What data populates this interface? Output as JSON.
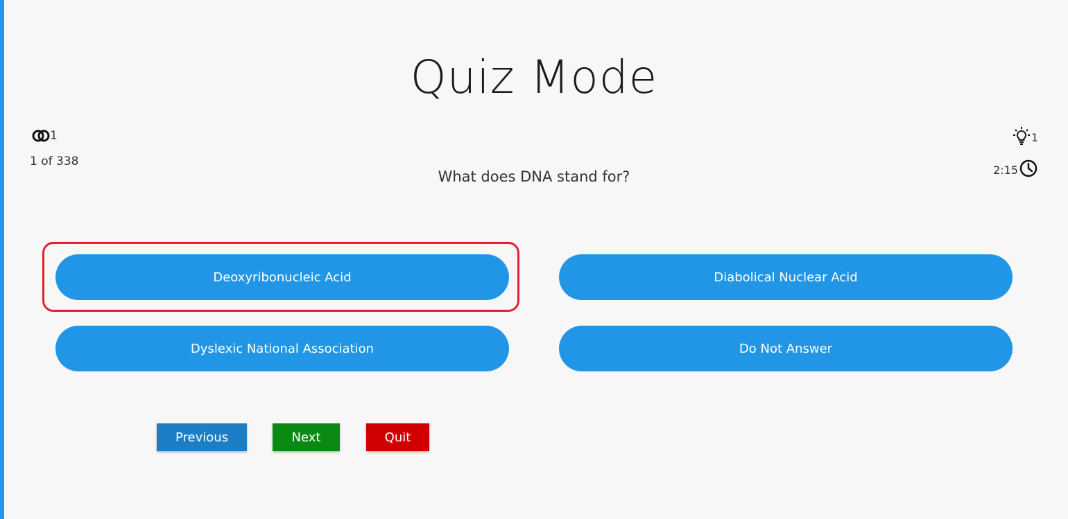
{
  "colors": {
    "accent": "#2196f3",
    "answer_button": "#2196e6",
    "previous_button": "#1b7ec6",
    "next_button": "#0a8a12",
    "quit_button": "#d00000",
    "highlight_border": "#e32030"
  },
  "header": {
    "title": "Quiz Mode"
  },
  "stats": {
    "lives_icon": "interlocking-rings-icon",
    "lives_count": "1",
    "progress": "1 of 338",
    "hints_icon": "lightbulb-icon",
    "hints_count": "1",
    "timer_value": "2:15",
    "timer_icon": "clock-icon"
  },
  "question": {
    "text": "What does DNA stand for?"
  },
  "answers": [
    {
      "label": "Deoxyribonucleic Acid",
      "highlighted": true
    },
    {
      "label": "Diabolical Nuclear Acid",
      "highlighted": false
    },
    {
      "label": "Dyslexic National Association",
      "highlighted": false
    },
    {
      "label": "Do Not Answer",
      "highlighted": false
    }
  ],
  "navigation": {
    "previous_label": "Previous",
    "next_label": "Next",
    "quit_label": "Quit"
  }
}
